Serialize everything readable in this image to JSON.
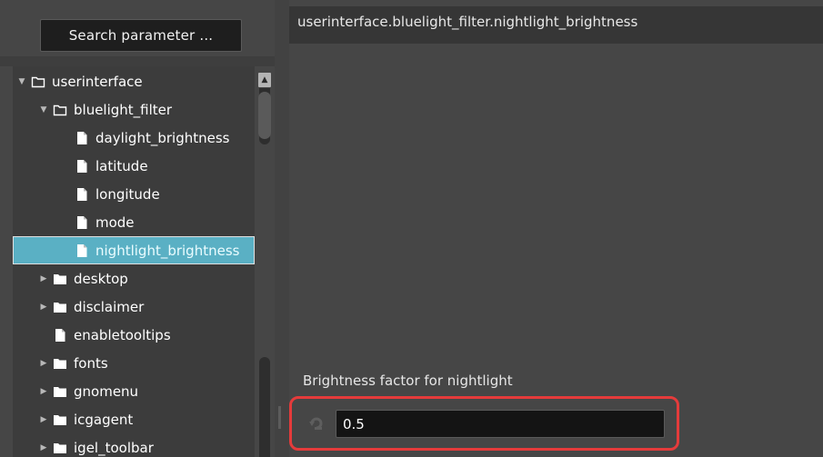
{
  "search": {
    "label": "Search parameter ..."
  },
  "path": "userinterface.bluelight_filter.nightlight_brightness",
  "tree": [
    {
      "label": "userinterface",
      "type": "folder",
      "state": "expanded",
      "depth": 0
    },
    {
      "label": "bluelight_filter",
      "type": "folder",
      "state": "expanded",
      "depth": 1
    },
    {
      "label": "daylight_brightness",
      "type": "file",
      "depth": 2
    },
    {
      "label": "latitude",
      "type": "file",
      "depth": 2
    },
    {
      "label": "longitude",
      "type": "file",
      "depth": 2
    },
    {
      "label": "mode",
      "type": "file",
      "depth": 2
    },
    {
      "label": "nightlight_brightness",
      "type": "file",
      "depth": 2,
      "selected": true
    },
    {
      "label": "desktop",
      "type": "folder",
      "state": "collapsed",
      "depth": 1
    },
    {
      "label": "disclaimer",
      "type": "folder",
      "state": "collapsed",
      "depth": 1
    },
    {
      "label": "enabletooltips",
      "type": "file",
      "depth": 1
    },
    {
      "label": "fonts",
      "type": "folder",
      "state": "collapsed",
      "depth": 1
    },
    {
      "label": "gnomenu",
      "type": "folder",
      "state": "collapsed",
      "depth": 1
    },
    {
      "label": "icgagent",
      "type": "folder",
      "state": "collapsed",
      "depth": 1
    },
    {
      "label": "igel_toolbar",
      "type": "folder",
      "state": "collapsed",
      "depth": 1
    }
  ],
  "parameter": {
    "label": "Brightness factor for nightlight",
    "value": "0.5",
    "reset_icon": "reset-icon"
  },
  "colors": {
    "panel": "#464646",
    "tree_bg": "#3c3c3c",
    "selection": "#5ab0c4",
    "highlight": "#e53b3b"
  }
}
